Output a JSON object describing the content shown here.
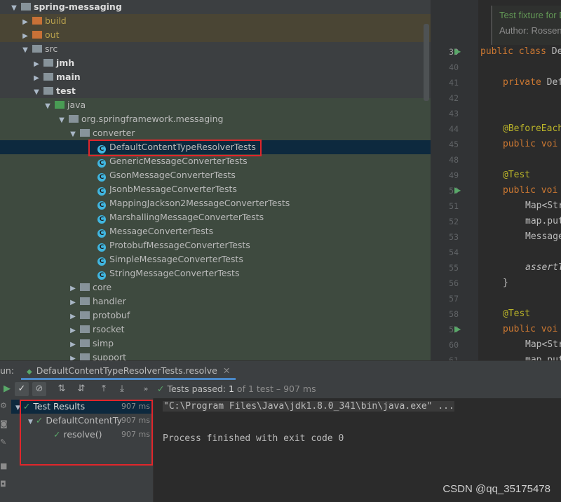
{
  "tree": {
    "root": "spring-messaging",
    "items": [
      {
        "label": "build"
      },
      {
        "label": "out"
      },
      {
        "label": "src"
      },
      {
        "label": "jmh"
      },
      {
        "label": "main"
      },
      {
        "label": "test"
      },
      {
        "label": "java"
      },
      {
        "label": "org.springframework.messaging"
      },
      {
        "label": "converter"
      }
    ],
    "classes": [
      "DefaultContentTypeResolverTests",
      "GenericMessageConverterTests",
      "GsonMessageConverterTests",
      "JsonbMessageConverterTests",
      "MappingJackson2MessageConverterTests",
      "MarshallingMessageConverterTests",
      "MessageConverterTests",
      "ProtobufMessageConverterTests",
      "SimpleMessageConverterTests",
      "StringMessageConverterTests"
    ],
    "packages": [
      "core",
      "handler",
      "protobuf",
      "rsocket",
      "simp",
      "support"
    ]
  },
  "editor": {
    "line_numbers": [
      "39",
      "40",
      "41",
      "42",
      "43",
      "44",
      "45",
      "48",
      "49",
      "50",
      "51",
      "52",
      "53",
      "54",
      "55",
      "56",
      "57",
      "58",
      "59",
      "60",
      "61"
    ],
    "doc1": "Test fixture for D",
    "doc2": "Author: Rossen S",
    "l39a": "public class ",
    "l39b": "De",
    "l41a": "private ",
    "l41b": "Def",
    "l44": "@BeforeEach",
    "l45a": "public ",
    "l45b": "voi",
    "l49": "@Test",
    "l50a": "public ",
    "l50b": "voi",
    "l51": "Map<Str",
    "l52": "map.put",
    "l53": "Message",
    "l55": "assertT",
    "l56": "}",
    "l58": "@Test",
    "l59a": "public ",
    "l59b": "voi",
    "l60": "Map<Str",
    "l61": "map.put"
  },
  "run": {
    "label": "un:",
    "tab": "DefaultContentTypeResolverTests.resolve",
    "status_prefix": "Tests passed: ",
    "status_count": "1",
    "status_rest": " of 1 test – 907 ms",
    "results": [
      {
        "label": "Test Results",
        "time": "907 ms"
      },
      {
        "label": "DefaultContentTy",
        "time": "907 ms"
      },
      {
        "label": "resolve()",
        "time": "907 ms"
      }
    ],
    "console_cmd": "\"C:\\Program Files\\Java\\jdk1.8.0_341\\bin\\java.exe\" ...",
    "console_exit": "Process finished with exit code 0"
  },
  "watermark": "CSDN @qq_35175478",
  "colors": {
    "highlight": "#e0262b",
    "pass": "#59a869",
    "selection": "#0d293e"
  }
}
